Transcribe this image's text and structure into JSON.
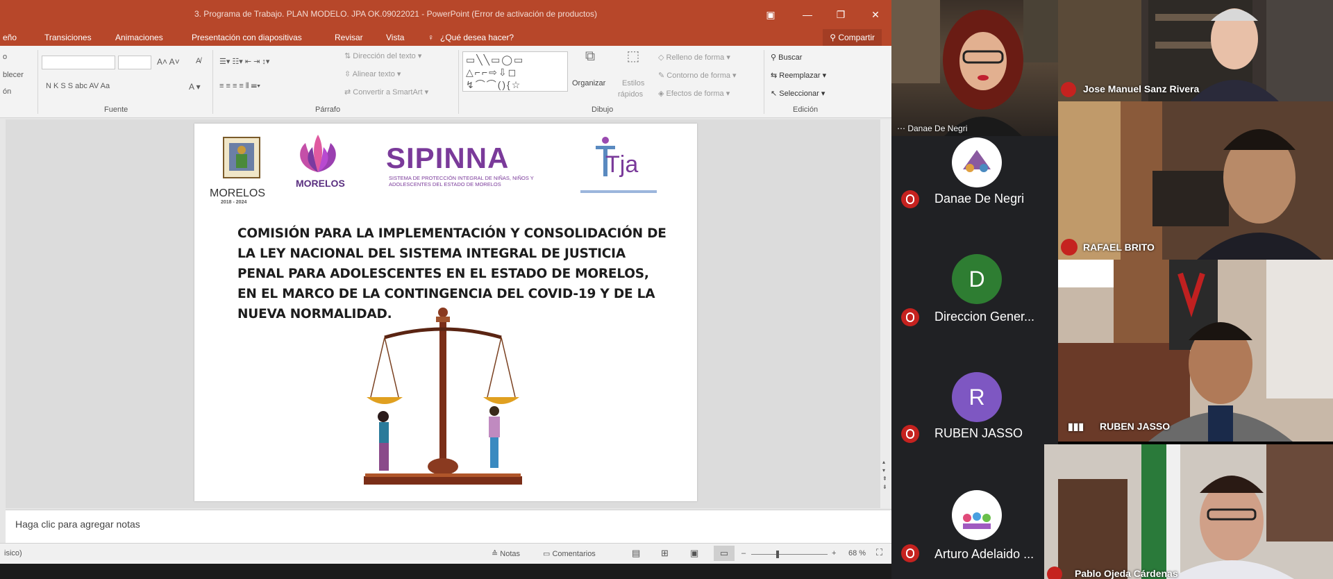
{
  "powerpoint": {
    "window_title": "3. Programa de Trabajo. PLAN MODELO. JPA OK.09022021 - PowerPoint (Error de activación de productos)",
    "menu": [
      "eño",
      "Transiciones",
      "Animaciones",
      "Presentación con diapositivas",
      "Revisar",
      "Vista"
    ],
    "tell_me": "¿Qué desea hacer?",
    "share_label": "Compartir",
    "ribbon": {
      "left_cut": [
        "o",
        "blecer",
        "ón"
      ],
      "fuente_label": "Fuente",
      "parrafo_label": "Párrafo",
      "dibujo_label": "Dibujo",
      "edicion_label": "Edición",
      "font_buttons": "N K S S abc AV Aa",
      "text_direction": "Dirección del texto",
      "align_text": "Alinear texto",
      "convert_smartart": "Convertir a SmartArt",
      "organize": "Organizar",
      "quick_styles_1": "Estilos",
      "quick_styles_2": "rápidos",
      "shape_fill": "Relleno de forma",
      "shape_outline": "Contorno de forma",
      "shape_effects": "Efectos de forma",
      "find": "Buscar",
      "replace": "Reemplazar",
      "select": "Seleccionar"
    },
    "slide": {
      "logo_morelos_1": "MORELOS",
      "logo_morelos_1_sub": "2018 - 2024",
      "logo_morelos_2": "MORELOS",
      "logo_sipinna": "SIPINNA",
      "logo_sipinna_sub": "SISTEMA DE PROTECCIÓN INTEGRAL DE NIÑAS, NIÑOS Y ADOLESCENTES DEL ESTADO DE MORELOS",
      "logo_tja": "Tja",
      "heading": "COMISIÓN PARA LA IMPLEMENTACIÓN Y CONSOLIDACIÓN DE LA LEY NACIONAL DEL SISTEMA INTEGRAL DE JUSTICIA PENAL PARA ADOLESCENTES EN EL ESTADO DE MORELOS, EN EL MARCO DE LA CONTINGENCIA DEL COVID-19 Y DE LA NUEVA NORMALIDAD."
    },
    "notes_placeholder": "Haga clic para agregar notas",
    "status": {
      "left": "isico)",
      "notes": "Notas",
      "comments": "Comentarios",
      "zoom": "68 %"
    }
  },
  "meet": {
    "list": [
      {
        "name": "Danae De Negri",
        "avatar": "",
        "avatar_kind": "image",
        "muted": true
      },
      {
        "name": "Direccion Gener...",
        "avatar": "D",
        "avatar_color": "#2e7d32",
        "muted": true
      },
      {
        "name": "RUBEN JASSO",
        "avatar": "R",
        "avatar_color": "#7e57c2",
        "muted": true
      },
      {
        "name": "Arturo Adelaido ...",
        "avatar": "",
        "avatar_kind": "image",
        "muted": true
      }
    ],
    "video_tiles": [
      {
        "name": "Danae De Negri"
      },
      {
        "name": "Jose Manuel Sanz Rivera"
      },
      {
        "name": "RAFAEL BRITO"
      },
      {
        "name": "RUBEN JASSO"
      },
      {
        "name": "Pablo Ojeda Cárdenas"
      }
    ]
  },
  "colors": {
    "ppt_accent": "#b7472a",
    "meet_bg": "#202124",
    "mute_red": "#c5221f"
  }
}
